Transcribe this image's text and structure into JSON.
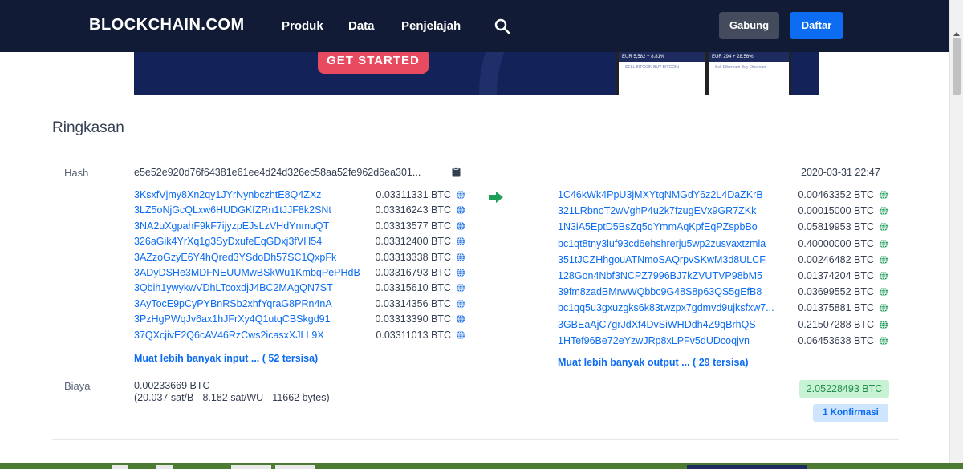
{
  "nav": {
    "logo": "BLOCKCHAIN.COM",
    "items": [
      "Produk",
      "Data",
      "Penjelajah"
    ],
    "login": "Gabung",
    "signup": "Daftar"
  },
  "banner": {
    "cta": "GET STARTED",
    "phone1_bar": "EUR 5,582   + 8.81%",
    "phone1_links": "SELL BITCOIN    BUY BITCOIN",
    "phone2_bar": "EUR 294   + 28.56%",
    "phone2_links": "Sell Ethereum   Buy Ethereum"
  },
  "summary": {
    "title": "Ringkasan",
    "hash_label": "Hash",
    "hash": "e5e52e920d76f64381e61ee4d24d326ec58aa52fe962d6ea301...",
    "date": "2020-03-31 22:47",
    "inputs": [
      {
        "address": "3KsxfVjmy8Xn2qy1JYrNynbczhtE8Q4ZXz",
        "amount": "0.03311331 BTC"
      },
      {
        "address": "3LZ5oNjGcQLxw6HUDGKfZRn1tJJF8k2SNt",
        "amount": "0.03316243 BTC"
      },
      {
        "address": "3NA2uXgpahF9kF7ijyzpEJsLzVHdYnmuQT",
        "amount": "0.03313577 BTC"
      },
      {
        "address": "326aGik4YrXq1g3SyDxufeEqGDxj3fVH54",
        "amount": "0.03312400 BTC"
      },
      {
        "address": "3AZzoGzyE6Y4hQred3YSdoDh57SC1QxpFk",
        "amount": "0.03313338 BTC"
      },
      {
        "address": "3ADyDSHe3MDFNEUUMwBSkWu1KmbqPePHdB",
        "amount": "0.03316793 BTC"
      },
      {
        "address": "3Qbih1ywykwVDhLTcoxdjJ4BC2MAgQN7ST",
        "amount": "0.03315610 BTC"
      },
      {
        "address": "3AyTocE9pCyPYBnRSb2xhfYqraG8PRn4nA",
        "amount": "0.03314356 BTC"
      },
      {
        "address": "3PzHgPWqJv6ax1hJFrXy4Q1utqCBSkgd91",
        "amount": "0.03313390 BTC"
      },
      {
        "address": "37QXcjivE2Q6cAV46RzCws2icasxXJLL9X",
        "amount": "0.03311013 BTC"
      }
    ],
    "more_inputs": "Muat lebih banyak input ... ( 52 tersisa)",
    "outputs": [
      {
        "address": "1C46kWk4PpU3jMXYtqNMGdY6z2L4DaZKrB",
        "amount": "0.00463352 BTC"
      },
      {
        "address": "321LRbnoT2wVghP4u2k7fzugEVx9GR7ZKk",
        "amount": "0.00015000 BTC"
      },
      {
        "address": "1N3iA5EptD5BsZq5qYmmAqKpfEqPZspbBo",
        "amount": "0.05819953 BTC"
      },
      {
        "address": "bc1qt8tny3luf93cd6ehshrerju5wp2zusvaxtzmla",
        "amount": "0.40000000 BTC"
      },
      {
        "address": "351tJCZHhgouATNmoSAQrpvSKwM3d8ULCF",
        "amount": "0.00246482 BTC"
      },
      {
        "address": "128Gon4Nbf3NCPZ7996BJ7kZVUTVP98bM5",
        "amount": "0.01374204 BTC"
      },
      {
        "address": "39fm8zadBMrwWQbbc9G48S8p63QS5gEfB8",
        "amount": "0.03699552 BTC"
      },
      {
        "address": "bc1qq5u3gxuzgks6k83twzpx7gdmvd9ujksfxw7...",
        "amount": "0.01375881 BTC"
      },
      {
        "address": "3GBEaAjC7grJdXf4DvSiWHDdh4Z9qBrhQS",
        "amount": "0.21507288 BTC"
      },
      {
        "address": "1HTef96Be72eYzwJRp8xLPFv5dUDcoqjvn",
        "amount": "0.06453638 BTC"
      }
    ],
    "more_outputs": "Muat lebih banyak output ... ( 29 tersisa)",
    "fee_label": "Biaya",
    "fee": "0.00233669 BTC",
    "fee_detail": "(20.037 sat/B - 8.182 sat/WU - 11662 bytes)",
    "total": "2.05228493 BTC",
    "confirmations": "1 Konfirmasi"
  },
  "colors": {
    "nav_bg": "#111b35",
    "link": "#0c6cf2",
    "green": "#1f8f48",
    "cta": "#e84a5f"
  },
  "icons": [
    "search-icon",
    "clipboard-icon",
    "arrow-right-icon",
    "globe-icon"
  ]
}
